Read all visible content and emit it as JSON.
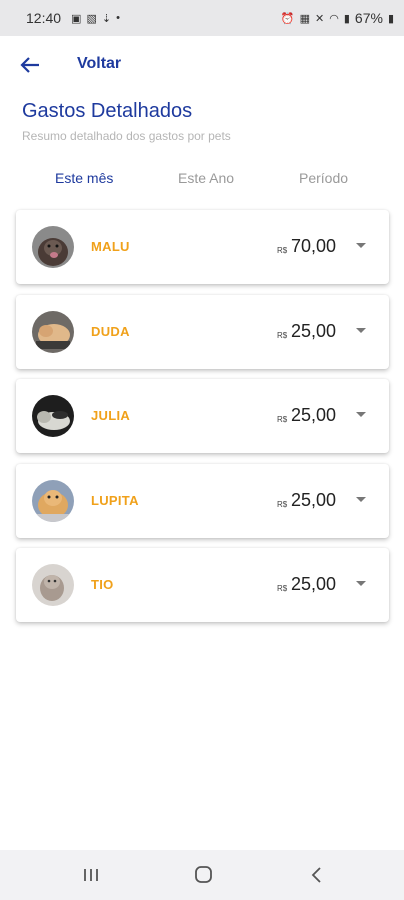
{
  "status_bar": {
    "time": "12:40",
    "battery_percent": "67%"
  },
  "header": {
    "back_label": "Voltar"
  },
  "page": {
    "title": "Gastos Detalhados",
    "subtitle": "Resumo detalhado dos gastos por pets"
  },
  "tabs": [
    {
      "label": "Este mês",
      "active": true
    },
    {
      "label": "Este Ano",
      "active": false
    },
    {
      "label": "Período",
      "active": false
    }
  ],
  "pets": [
    {
      "name": "MALU",
      "currency": "R$",
      "amount": "70,00",
      "avatar_icon": "dog-photo"
    },
    {
      "name": "DUDA",
      "currency": "R$",
      "amount": "25,00",
      "avatar_icon": "cat-photo"
    },
    {
      "name": "JULIA",
      "currency": "R$",
      "amount": "25,00",
      "avatar_icon": "cat-photo"
    },
    {
      "name": "LUPITA",
      "currency": "R$",
      "amount": "25,00",
      "avatar_icon": "cat-photo"
    },
    {
      "name": "TIO",
      "currency": "R$",
      "amount": "25,00",
      "avatar_icon": "cat-photo"
    }
  ],
  "colors": {
    "primary": "#1e3a9e",
    "pet_name": "#f0a11b",
    "inactive_tab": "#9a9a9a"
  }
}
